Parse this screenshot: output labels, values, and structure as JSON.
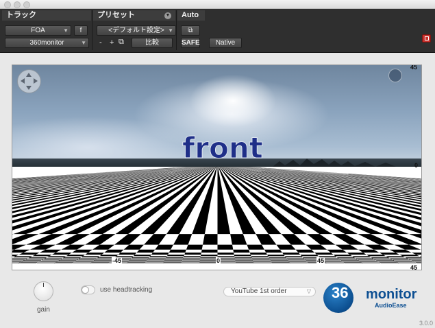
{
  "window": {},
  "toolbar": {
    "track_header": "トラック",
    "preset_header": "プリセット",
    "auto_header": "Auto",
    "track_format": "FOA",
    "f_label": "f",
    "plugin_name": "360monitor",
    "preset_name": "<デフォルト設定>",
    "minus": "-",
    "plus": "+",
    "compare": "比較",
    "safe": "SAFE",
    "native": "Native"
  },
  "viewer": {
    "overlay_text": "front",
    "ticks": {
      "top_right": "45",
      "right_mid": "0",
      "bottom_left": "-45",
      "bottom_center": "0",
      "bottom_right_inner": "45",
      "bottom_right": "45"
    }
  },
  "controls": {
    "gain_label": "gain",
    "gain_level": 0.5,
    "headtracking_label": "use headtracking",
    "headtracking_on": false,
    "decoder_selected": "YouTube 1st order"
  },
  "brand": {
    "logo_number": "36",
    "logo_word": "monitor",
    "logo_sub": "AudioEase",
    "version": "3.0.0"
  },
  "colors": {
    "toolbar_bg": "#2f2f2f",
    "accent_blue": "#0d4f92",
    "close_red": "#c8312d"
  }
}
